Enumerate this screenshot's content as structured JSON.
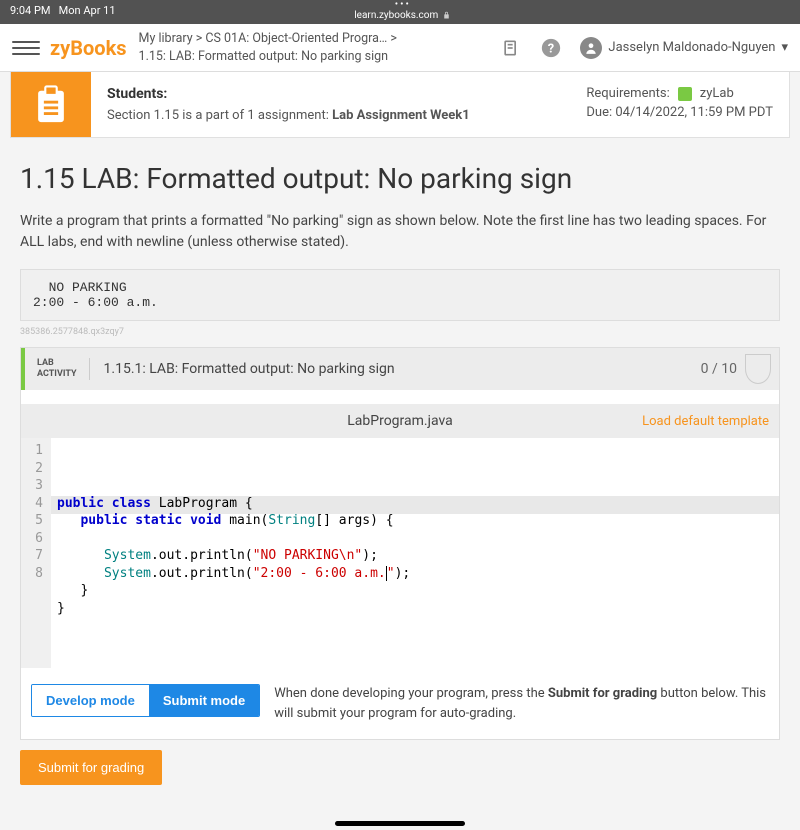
{
  "status": {
    "time": "9:04 PM",
    "date": "Mon Apr 11",
    "url": "learn.zybooks.com"
  },
  "topbar": {
    "logo": "zyBooks",
    "breadcrumb_line1": "My library > CS 01A: Object-Oriented Progra…    >",
    "breadcrumb_line2": "1.15: LAB: Formatted output: No parking sign",
    "user_name": "Jasselyn Maldonado-Nguyen"
  },
  "banner": {
    "heading": "Students:",
    "text_prefix": "Section 1.15 is a part of 1 assignment: ",
    "assignment_name": "Lab Assignment Week1",
    "requirements_label": "Requirements:",
    "requirements_value": "zyLab",
    "due_text": "Due: 04/14/2022, 11:59 PM PDT"
  },
  "lab": {
    "title": "1.15 LAB: Formatted output: No parking sign",
    "description": "Write a program that prints a formatted \"No parking\" sign as shown below. Note the first line has two leading spaces. For ALL labs, end with newline (unless otherwise stated).",
    "sample_output": "  NO PARKING\n2:00 - 6:00 a.m.",
    "tiny_id": "385386.2577848.qx3zqy7"
  },
  "activity": {
    "label_line1": "LAB",
    "label_line2": "ACTIVITY",
    "title": "1.15.1: LAB: Formatted output: No parking sign",
    "score": "0 / 10"
  },
  "editor": {
    "filename": "LabProgram.java",
    "load_link": "Load default template",
    "line_numbers": [
      "1",
      "2",
      "3",
      "4",
      "5",
      "6",
      "7",
      "8"
    ]
  },
  "modes": {
    "develop": "Develop mode",
    "submit": "Submit mode",
    "footer_text_prefix": "When done developing your program, press the ",
    "footer_text_bold": "Submit for grading",
    "footer_text_suffix": " button below. This will submit your program for auto-grading."
  },
  "submit_button": "Submit for grading"
}
